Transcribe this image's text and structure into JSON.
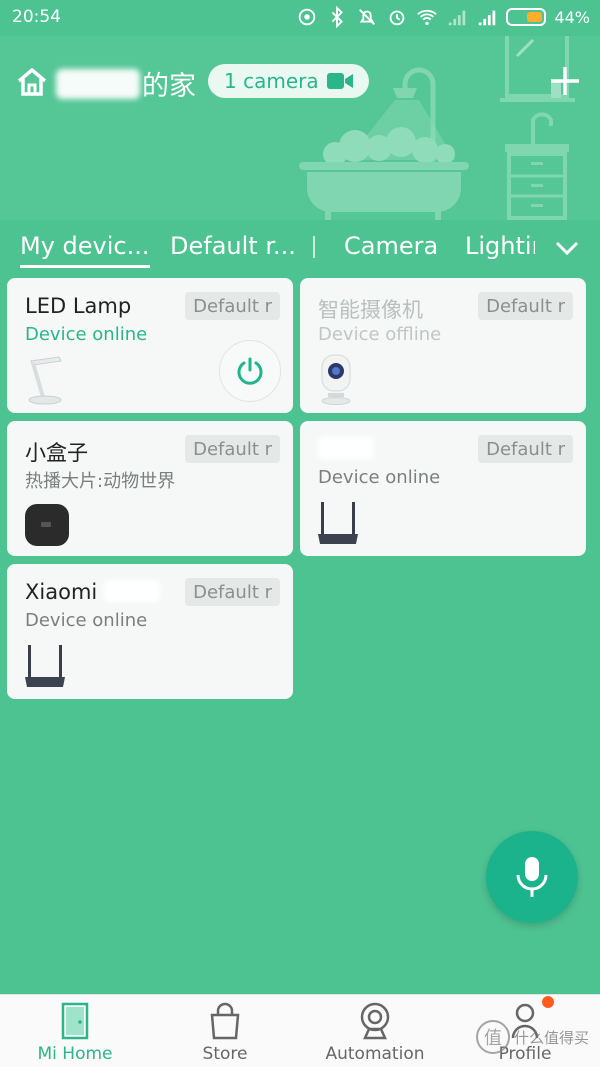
{
  "status_bar": {
    "time": "20:54",
    "battery_percent": "44%",
    "battery_level": 0.44,
    "icons": [
      "sync-icon",
      "bluetooth-icon",
      "mute-icon",
      "alarm-icon",
      "wifi-icon",
      "signal-icon",
      "signal-icon",
      "battery-icon"
    ]
  },
  "header": {
    "home_title_suffix": "的家",
    "camera_pill_label": "1 camera",
    "colors": {
      "bg": "#55c696",
      "pill_text": "#2ab58a"
    }
  },
  "tabs": [
    {
      "label": "My devic...",
      "active": true
    },
    {
      "label": "Default r...",
      "active": false
    },
    {
      "label": "Camera",
      "active": false
    },
    {
      "label": "Lightir",
      "active": false
    }
  ],
  "devices": [
    {
      "name": "LED Lamp",
      "status": "Device online",
      "room": "Default r",
      "has_power_button": true,
      "online": true
    },
    {
      "name": "智能摄像机",
      "status": "Device offline",
      "room": "Default r",
      "online": false
    },
    {
      "name": "小盒子",
      "status": "热播大片:动物世界",
      "room": "Default r",
      "online": true
    },
    {
      "name": "",
      "status": "Device online",
      "room": "Default r",
      "online": true
    },
    {
      "name": "Xiaomi",
      "status": "Device online",
      "room": "Default r",
      "online": true
    }
  ],
  "bottom_nav": [
    {
      "label": "Mi Home",
      "icon": "door-icon",
      "active": true
    },
    {
      "label": "Store",
      "icon": "bag-icon",
      "active": false
    },
    {
      "label": "Automation",
      "icon": "automation-icon",
      "active": false
    },
    {
      "label": "Profile",
      "icon": "profile-icon",
      "active": false
    }
  ],
  "watermark": {
    "text": "什么值得买",
    "logo_char": "值"
  }
}
